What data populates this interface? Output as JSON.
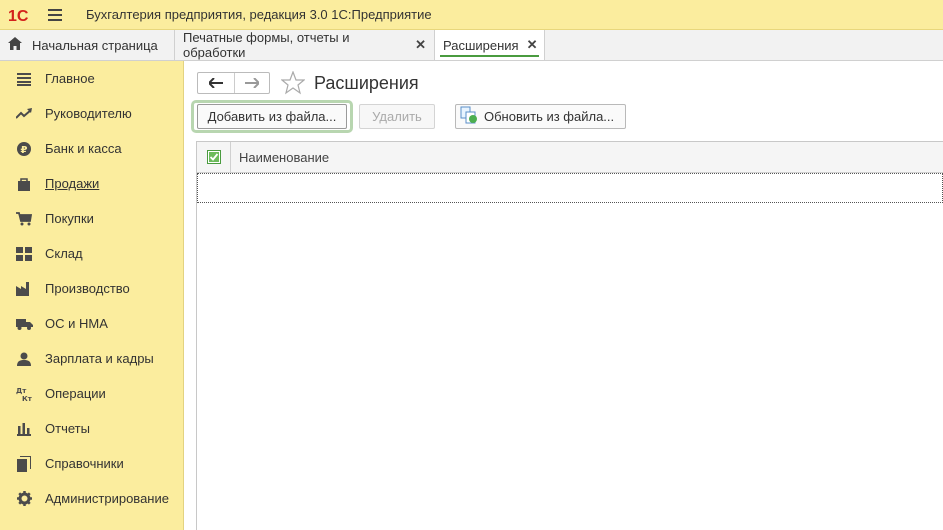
{
  "titlebar": {
    "logo_text": "1С",
    "title": "Бухгалтерия предприятия, редакция 3.0 1С:Предприятие"
  },
  "tabs": [
    {
      "label": "Начальная страница",
      "icon": "home-icon"
    },
    {
      "label": "Печатные формы, отчеты и обработки",
      "closable": true
    },
    {
      "label": "Расширения",
      "closable": true,
      "active": true
    }
  ],
  "sidebar": {
    "items": [
      {
        "label": "Главное",
        "icon": "list-icon"
      },
      {
        "label": "Руководителю",
        "icon": "trend-icon"
      },
      {
        "label": "Банк и касса",
        "icon": "ruble-icon"
      },
      {
        "label": "Продажи",
        "icon": "bag-icon"
      },
      {
        "label": "Покупки",
        "icon": "cart-icon"
      },
      {
        "label": "Склад",
        "icon": "warehouse-icon"
      },
      {
        "label": "Производство",
        "icon": "factory-icon"
      },
      {
        "label": "ОС и НМА",
        "icon": "truck-icon"
      },
      {
        "label": "Зарплата и кадры",
        "icon": "person-icon"
      },
      {
        "label": "Операции",
        "icon": "dt-kt-icon"
      },
      {
        "label": "Отчеты",
        "icon": "bar-chart-icon"
      },
      {
        "label": "Справочники",
        "icon": "books-icon"
      },
      {
        "label": "Администрирование",
        "icon": "gear-icon"
      }
    ]
  },
  "main": {
    "title": "Расширения",
    "buttons": {
      "add": "Добавить из файла...",
      "delete": "Удалить",
      "update": "Обновить из файла..."
    },
    "table": {
      "columns": [
        "Наименование"
      ]
    }
  },
  "colors": {
    "accent_yellow": "#fbed9e",
    "active_tab_underline": "#4a9b3f",
    "logo_red": "#d3221c"
  }
}
